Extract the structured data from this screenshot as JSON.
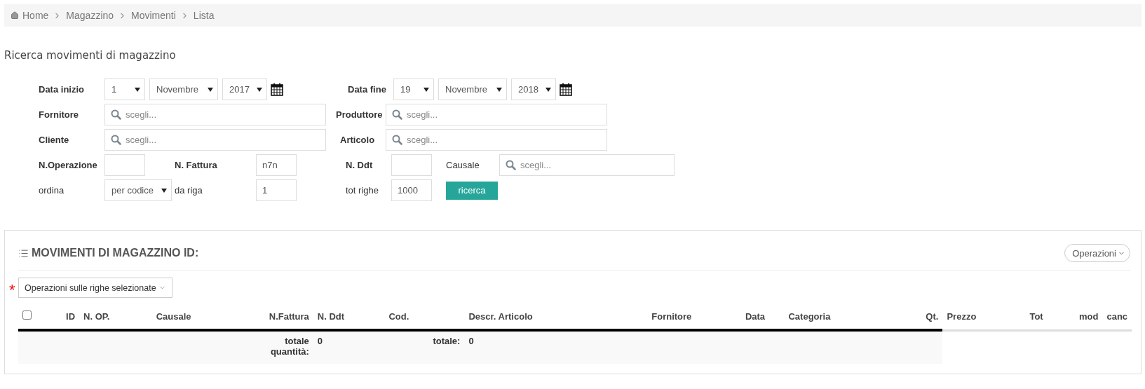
{
  "breadcrumb": [
    "Home",
    "Magazzino",
    "Movimenti",
    "Lista"
  ],
  "page_title": "Ricerca movimenti di magazzino",
  "form": {
    "start_date": {
      "label": "Data inizio",
      "day": "1",
      "month": "Novembre",
      "year": "2017"
    },
    "end_date": {
      "label": "Data fine",
      "day": "19",
      "month": "Novembre",
      "year": "2018"
    },
    "supplier": {
      "label": "Fornitore",
      "placeholder": "scegli..."
    },
    "producer": {
      "label": "Produttore",
      "placeholder": "scegli..."
    },
    "customer": {
      "label": "Cliente",
      "placeholder": "scegli..."
    },
    "article": {
      "label": "Articolo",
      "placeholder": "scegli..."
    },
    "operation_number": {
      "label": "N.Operazione"
    },
    "invoice_number": {
      "label": "N. Fattura",
      "value": "n7n"
    },
    "ddt_number": {
      "label": "N. Ddt"
    },
    "reason": {
      "label": "Causale",
      "placeholder": "scegli..."
    },
    "sort": {
      "label": "ordina",
      "value": "per codice"
    },
    "from_row": {
      "label": "da riga",
      "value": "1"
    },
    "total_rows": {
      "label": "tot righe",
      "value": "1000"
    },
    "search_button": "ricerca"
  },
  "panel": {
    "title": "MOVIMENTI DI MAGAZZINO ID:",
    "operations_button": "Operazioni",
    "required_mark": "*",
    "bulk_button": "Operazioni sulle righe selezionate",
    "table": {
      "select_all": {
        "checked": false
      },
      "columns": [
        {
          "label": "ID",
          "kind": "main"
        },
        {
          "label": "N. OP.",
          "kind": "main"
        },
        {
          "label": "Causale",
          "kind": "main"
        },
        {
          "label": "N.Fattura",
          "kind": "main"
        },
        {
          "label": "N. Ddt",
          "kind": "main"
        },
        {
          "label": "Cod.",
          "kind": "main"
        },
        {
          "label": "Descr. Articolo",
          "kind": "main"
        },
        {
          "label": "Fornitore",
          "kind": "main"
        },
        {
          "label": "Data",
          "kind": "main"
        },
        {
          "label": "Categoria",
          "kind": "main"
        },
        {
          "label": "Qt.",
          "kind": "main"
        },
        {
          "label": "Prezzo",
          "kind": "extra"
        },
        {
          "label": "Tot",
          "kind": "extra"
        },
        {
          "label": "mod",
          "kind": "extra"
        },
        {
          "label": "canc",
          "kind": "extra"
        }
      ],
      "footer": {
        "quantity_label": "totale quantità:",
        "quantity": "0",
        "total_label": "totale:",
        "total": "0"
      }
    }
  }
}
